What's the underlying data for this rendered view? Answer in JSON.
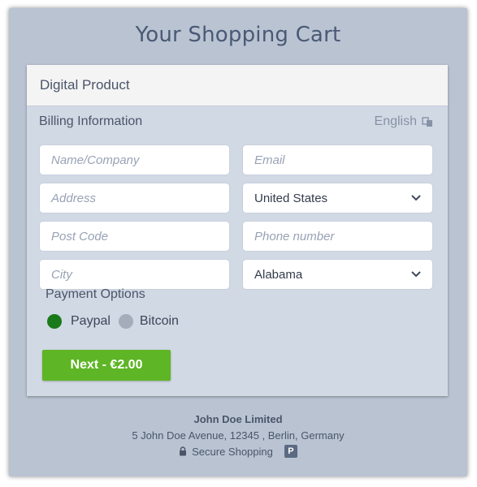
{
  "header": {
    "title": "Your Shopping Cart"
  },
  "panel": {
    "title": "Digital Product"
  },
  "billing": {
    "label": "Billing Information",
    "language": "English",
    "fields": {
      "name_placeholder": "Name/Company",
      "email_placeholder": "Email",
      "address_placeholder": "Address",
      "country_value": "United States",
      "postcode_placeholder": "Post Code",
      "phone_placeholder": "Phone number",
      "city_placeholder": "City",
      "state_value": "Alabama"
    }
  },
  "payment": {
    "label": "Payment Options",
    "options": [
      {
        "label": "Paypal",
        "selected": true
      },
      {
        "label": "Bitcoin",
        "selected": false
      }
    ]
  },
  "cta": {
    "label": "Next - €2.00"
  },
  "footer": {
    "company": "John Doe Limited",
    "address": "5 John Doe Avenue, 12345 , Berlin, Germany",
    "secure": "Secure Shopping",
    "badge": "P"
  },
  "colors": {
    "accent": "#5eb525",
    "selected_radio": "#1a7a1a",
    "background": "#b9c3d2"
  }
}
